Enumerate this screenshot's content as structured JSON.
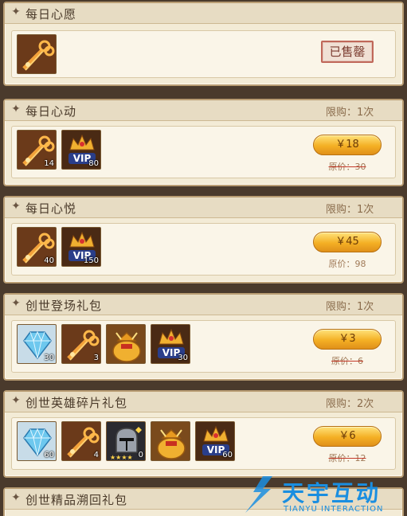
{
  "packages": [
    {
      "title": "每日心愿",
      "status": "已售罄",
      "items": [
        {
          "icon": "key-icon",
          "count": ""
        }
      ]
    },
    {
      "title": "每日心动",
      "limit": "限购：1次",
      "price": "￥18",
      "original": "原价：30",
      "items": [
        {
          "icon": "key-icon",
          "count": "14"
        },
        {
          "icon": "vip-crown-icon",
          "count": "80"
        }
      ]
    },
    {
      "title": "每日心悦",
      "limit": "限购：1次",
      "price": "￥45",
      "original": "原价：98",
      "items": [
        {
          "icon": "key-icon",
          "count": "40"
        },
        {
          "icon": "vip-crown-icon",
          "count": "150"
        }
      ]
    },
    {
      "title": "创世登场礼包",
      "limit": "限购：1次",
      "price": "￥3",
      "original": "原价：6",
      "items": [
        {
          "icon": "diamond-icon",
          "count": "30"
        },
        {
          "icon": "key-icon",
          "count": "3"
        },
        {
          "icon": "treasure-bag-icon",
          "count": ""
        },
        {
          "icon": "vip-crown-icon",
          "count": "30"
        }
      ]
    },
    {
      "title": "创世英雄碎片礼包",
      "limit": "限购：2次",
      "price": "￥6",
      "original": "原价：12",
      "items": [
        {
          "icon": "diamond-icon",
          "count": "60"
        },
        {
          "icon": "key-icon",
          "count": "4"
        },
        {
          "icon": "helmet-icon",
          "count": "0"
        },
        {
          "icon": "treasure-bag-icon",
          "count": ""
        },
        {
          "icon": "vip-crown-icon",
          "count": "60"
        }
      ]
    },
    {
      "title": "创世精品溯回礼包"
    }
  ],
  "watermark": {
    "cn": "天宇互动",
    "en": "TIANYU INTERACTION"
  },
  "colors": {
    "card_bg": "#f3ebd6",
    "header_bg": "#e7dcc3",
    "button_gold": "#f4b024",
    "sold_red": "#c0685a",
    "watermark_blue": "#1a8ee0"
  }
}
